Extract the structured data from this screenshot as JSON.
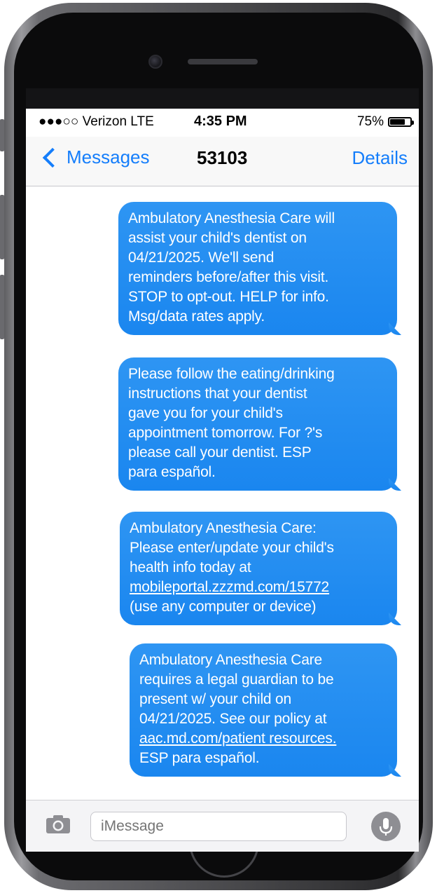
{
  "status_bar": {
    "carrier": "●●●○○ Verizon  LTE",
    "time": "4:35 PM",
    "battery_text": "75%",
    "battery_level": 0.75
  },
  "nav": {
    "back_label": "Messages",
    "title": "53103",
    "details_label": "Details"
  },
  "messages": [
    {
      "lines": [
        "Ambulatory Anesthesia Care will",
        "assist your child's dentist on",
        "04/21/2025. We'll send",
        "reminders before/after this visit.",
        "STOP to opt-out. HELP for info.",
        "Msg/data rates apply."
      ]
    },
    {
      "lines": [
        "Please follow the eating/drinking",
        "instructions that your dentist",
        "gave you for your child's",
        "appointment tomorrow. For ?'s",
        "please call your dentist. ESP",
        "para español."
      ]
    },
    {
      "lines": [
        "Ambulatory Anesthesia Care:",
        "Please enter/update your child's",
        "health info today at",
        "mobileportal.zzzmd.com/15772",
        "(use any computer or device)"
      ]
    },
    {
      "lines": [
        "Ambulatory Anesthesia Care",
        "requires a legal guardian to be",
        "present w/ your child on",
        "04/21/2025. See our policy at",
        "aac.md.com/patient resources.",
        "ESP para español."
      ]
    }
  ],
  "input": {
    "placeholder": "iMessage"
  },
  "icons": {
    "camera": "camera-icon",
    "mic": "microphone-icon",
    "back": "chevron-left-icon"
  },
  "colors": {
    "accent": "#157efb",
    "bubble": "#1a86ef"
  }
}
